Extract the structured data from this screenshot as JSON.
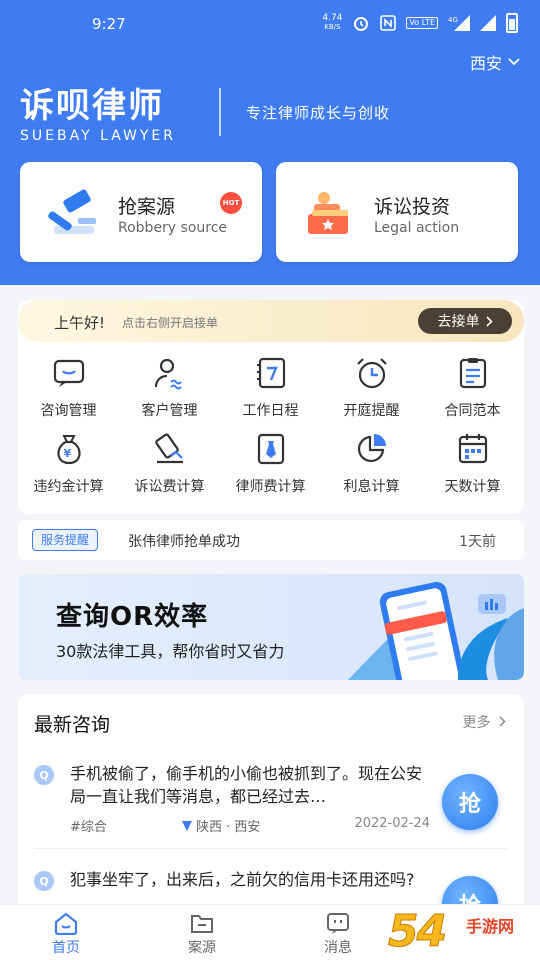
{
  "status_bar": {
    "time": "9:27",
    "net_speed": "4.74",
    "net_unit": "KB/S",
    "volte": "Vo LTE",
    "signal": "4G"
  },
  "header": {
    "city": "西安",
    "logo_cn": "诉呗律师",
    "logo_en": "SUEBAY LAWYER",
    "slogan": "专注律师成长与创收"
  },
  "cards": [
    {
      "title": "抢案源",
      "subtitle": "Robbery source",
      "badge": "HOT",
      "icon": "gavel-icon"
    },
    {
      "title": "诉讼投资",
      "subtitle": "Legal action",
      "icon": "investment-icon"
    }
  ],
  "greeting": {
    "title": "上午好!",
    "tip": "点击右侧开启接单",
    "button": "去接单"
  },
  "tools": [
    {
      "label": "咨询管理",
      "icon": "chat-icon"
    },
    {
      "label": "客户管理",
      "icon": "client-icon"
    },
    {
      "label": "工作日程",
      "icon": "calendar-icon"
    },
    {
      "label": "开庭提醒",
      "icon": "alarm-icon"
    },
    {
      "label": "合同范本",
      "icon": "contract-icon"
    },
    {
      "label": "违约金计算",
      "icon": "money-bag-icon"
    },
    {
      "label": "诉讼费计算",
      "icon": "fee-icon"
    },
    {
      "label": "律师费计算",
      "icon": "tie-icon"
    },
    {
      "label": "利息计算",
      "icon": "pie-icon"
    },
    {
      "label": "天数计算",
      "icon": "days-calendar-icon"
    }
  ],
  "notice": {
    "tag": "服务提醒",
    "message": "张伟律师抢单成功",
    "time": "1天前"
  },
  "banner": {
    "title": "查询OR效率",
    "subtitle": "30款法律工具，帮你省时又省力"
  },
  "consult": {
    "heading": "最新咨询",
    "more": "更多",
    "grab_label": "抢",
    "items": [
      {
        "badge": "Q",
        "text": "手机被偷了，偷手机的小偷也被抓到了。现在公安局一直让我们等消息，都已经过去…",
        "tag": "#综合",
        "location": "陕西 · 西安",
        "date": "2022-02-24"
      },
      {
        "badge": "Q",
        "text": "犯事坐牢了，出来后，之前欠的信用卡还用还吗?"
      }
    ]
  },
  "tabbar": [
    {
      "label": "首页",
      "icon": "home-icon",
      "active": true
    },
    {
      "label": "案源",
      "icon": "folder-icon"
    },
    {
      "label": "消息",
      "icon": "message-icon"
    }
  ],
  "watermark": {
    "digits": "54",
    "text1": "手游",
    "text2": "网"
  },
  "colors": {
    "brand_blue": "#3f7cf2",
    "hot_red": "#ff4f3f",
    "greet_btn": "#4a4036"
  }
}
